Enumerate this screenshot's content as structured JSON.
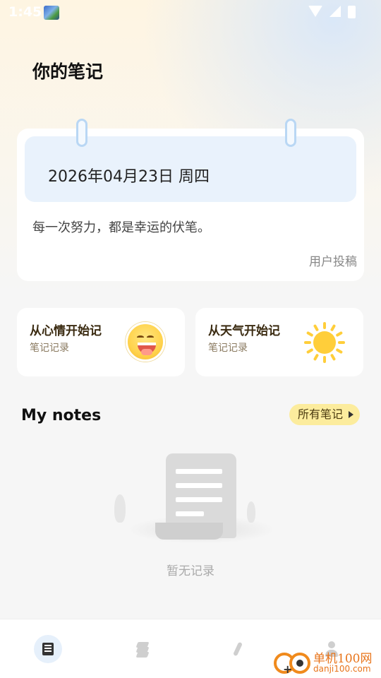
{
  "status_bar": {
    "time": "1:45"
  },
  "header": {
    "title": "你的笔记"
  },
  "date_card": {
    "date": "2026年04月23日 周四",
    "quote": "每一次努力，都是幸运的伏笔。",
    "source": "用户投稿"
  },
  "entries": [
    {
      "title": "从心情开始记",
      "subtitle": "笔记记录",
      "icon": "mood-face-icon"
    },
    {
      "title": "从天气开始记",
      "subtitle": "笔记记录",
      "icon": "sun-icon"
    }
  ],
  "notes_section": {
    "title": "My notes",
    "all_notes_label": "所有笔记",
    "empty_text": "暂无记录"
  },
  "bottom_nav": [
    {
      "name": "notes",
      "icon": "notebook-icon",
      "active": true
    },
    {
      "name": "layers",
      "icon": "layers-icon",
      "active": false
    },
    {
      "name": "write",
      "icon": "pen-icon",
      "active": false
    },
    {
      "name": "profile",
      "icon": "person-icon",
      "active": false
    }
  ],
  "watermark": {
    "name": "单机100网",
    "url": "danji100.com"
  },
  "colors": {
    "accent_yellow": "#fcec9d",
    "date_box_blue": "#e9f2fc",
    "watermark_orange": "#f08a1c"
  }
}
